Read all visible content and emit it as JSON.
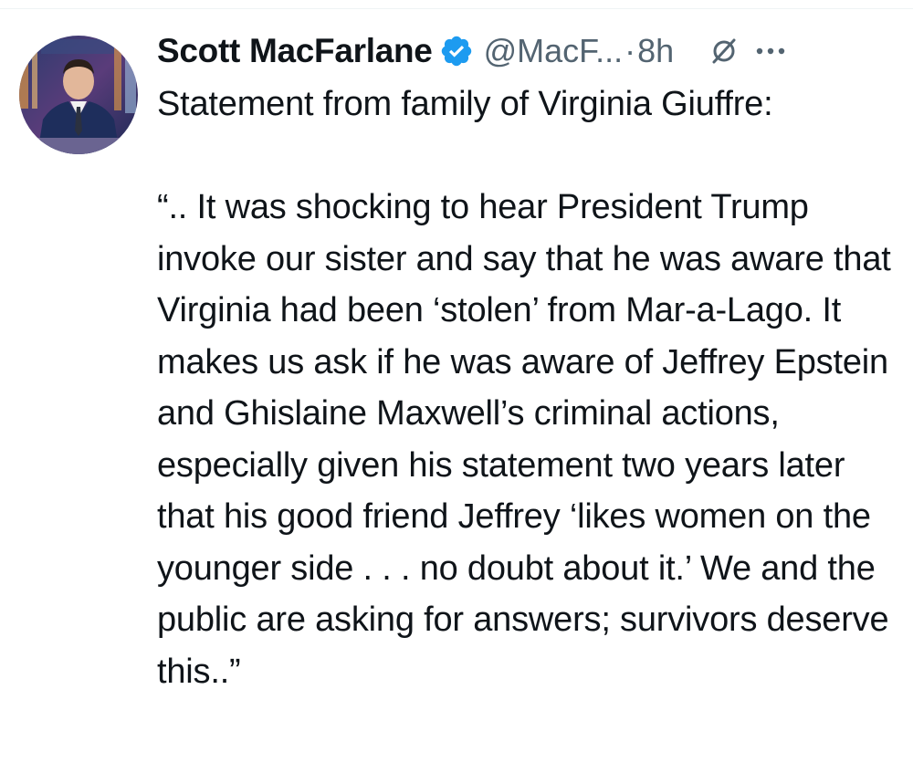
{
  "author": {
    "display_name": "Scott MacFarlane",
    "handle": "@MacF...",
    "separator": "·",
    "time": "8h",
    "verified": true,
    "verified_color": "#1d9bf0"
  },
  "icons": {
    "avatar": "avatar",
    "verified": "verified-badge-icon",
    "grok": "grok-icon",
    "more": "more-icon"
  },
  "tweet": {
    "lead": "Statement from family of Virginia Giuffre:",
    "quote": "“.. It was shocking to hear President Trump invoke our sister and say that he was aware that Virginia had been ‘stolen’ from Mar-a-Lago. It makes us ask if he was aware of Jeffrey Epstein and Ghislaine Maxwell’s criminal actions, especially given his statement two years later that his good friend Jeffrey ‘likes women on the younger side . . . no doubt about it.’ We and the public are asking for answers; survivors deserve this..”"
  }
}
